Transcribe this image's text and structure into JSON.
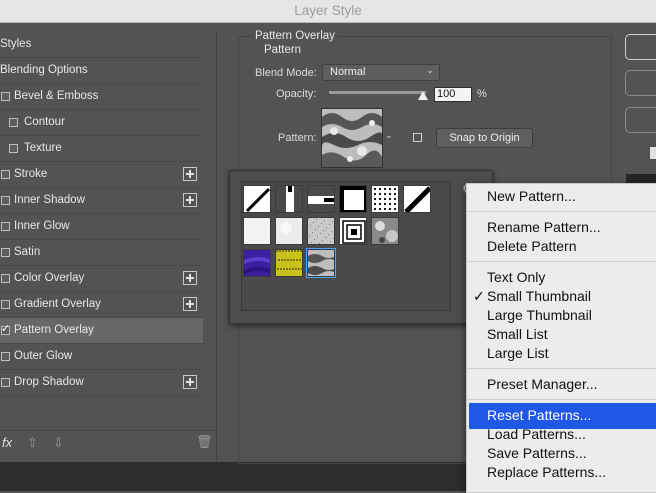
{
  "window": {
    "title": "Layer Style"
  },
  "styles_list": {
    "header": "Styles",
    "items": [
      {
        "label": "Blending Options",
        "checkbox": false,
        "checked": false,
        "plus": false
      },
      {
        "label": "Bevel & Emboss",
        "checkbox": true,
        "checked": false,
        "plus": false
      },
      {
        "label": "Contour",
        "checkbox": true,
        "checked": false,
        "plus": false,
        "indent": true
      },
      {
        "label": "Texture",
        "checkbox": true,
        "checked": false,
        "plus": false,
        "indent": true
      },
      {
        "label": "Stroke",
        "checkbox": true,
        "checked": false,
        "plus": true
      },
      {
        "label": "Inner Shadow",
        "checkbox": true,
        "checked": false,
        "plus": true
      },
      {
        "label": "Inner Glow",
        "checkbox": true,
        "checked": false,
        "plus": false
      },
      {
        "label": "Satin",
        "checkbox": true,
        "checked": false,
        "plus": false
      },
      {
        "label": "Color Overlay",
        "checkbox": true,
        "checked": false,
        "plus": true
      },
      {
        "label": "Gradient Overlay",
        "checkbox": true,
        "checked": false,
        "plus": true
      },
      {
        "label": "Pattern Overlay",
        "checkbox": true,
        "checked": true,
        "plus": false,
        "selected": true
      },
      {
        "label": "Outer Glow",
        "checkbox": true,
        "checked": false,
        "plus": false
      },
      {
        "label": "Drop Shadow",
        "checkbox": true,
        "checked": false,
        "plus": true
      }
    ],
    "footer": {
      "fx_label": "fx"
    }
  },
  "pattern_overlay": {
    "section_title": "Pattern Overlay",
    "subsection_title": "Pattern",
    "blend_mode_label": "Blend Mode:",
    "blend_mode_value": "Normal",
    "opacity_label": "Opacity:",
    "opacity_value": "100",
    "opacity_unit": "%",
    "opacity_level": 1.0,
    "pattern_label": "Pattern:",
    "snap_button": "Snap to Origin"
  },
  "pattern_picker": {
    "thumbnails": [
      "diagonal-line",
      "vertical-bar",
      "horizontal-bar",
      "square-outline",
      "dots",
      "diagonal-stripe",
      "white-texture",
      "white-light",
      "gray-noise",
      "concentric-squares",
      "gray-rock",
      "purple-texture",
      "yellow-texture",
      "gray-marble"
    ],
    "selected_index": 13
  },
  "context_menu": {
    "groups": [
      [
        {
          "label": "New Pattern..."
        }
      ],
      [
        {
          "label": "Rename Pattern..."
        },
        {
          "label": "Delete Pattern"
        }
      ],
      [
        {
          "label": "Text Only"
        },
        {
          "label": "Small Thumbnail",
          "checked": true
        },
        {
          "label": "Large Thumbnail"
        },
        {
          "label": "Small List"
        },
        {
          "label": "Large List"
        }
      ],
      [
        {
          "label": "Preset Manager..."
        }
      ],
      [
        {
          "label": "Reset Patterns...",
          "highlighted": true
        },
        {
          "label": "Load Patterns..."
        },
        {
          "label": "Save Patterns..."
        },
        {
          "label": "Replace Patterns..."
        }
      ]
    ],
    "highlight_color": "#1f57e6"
  },
  "colors": {
    "panel_bg": "#535353",
    "selected_row": "#676767",
    "menu_bg": "#ececec"
  }
}
